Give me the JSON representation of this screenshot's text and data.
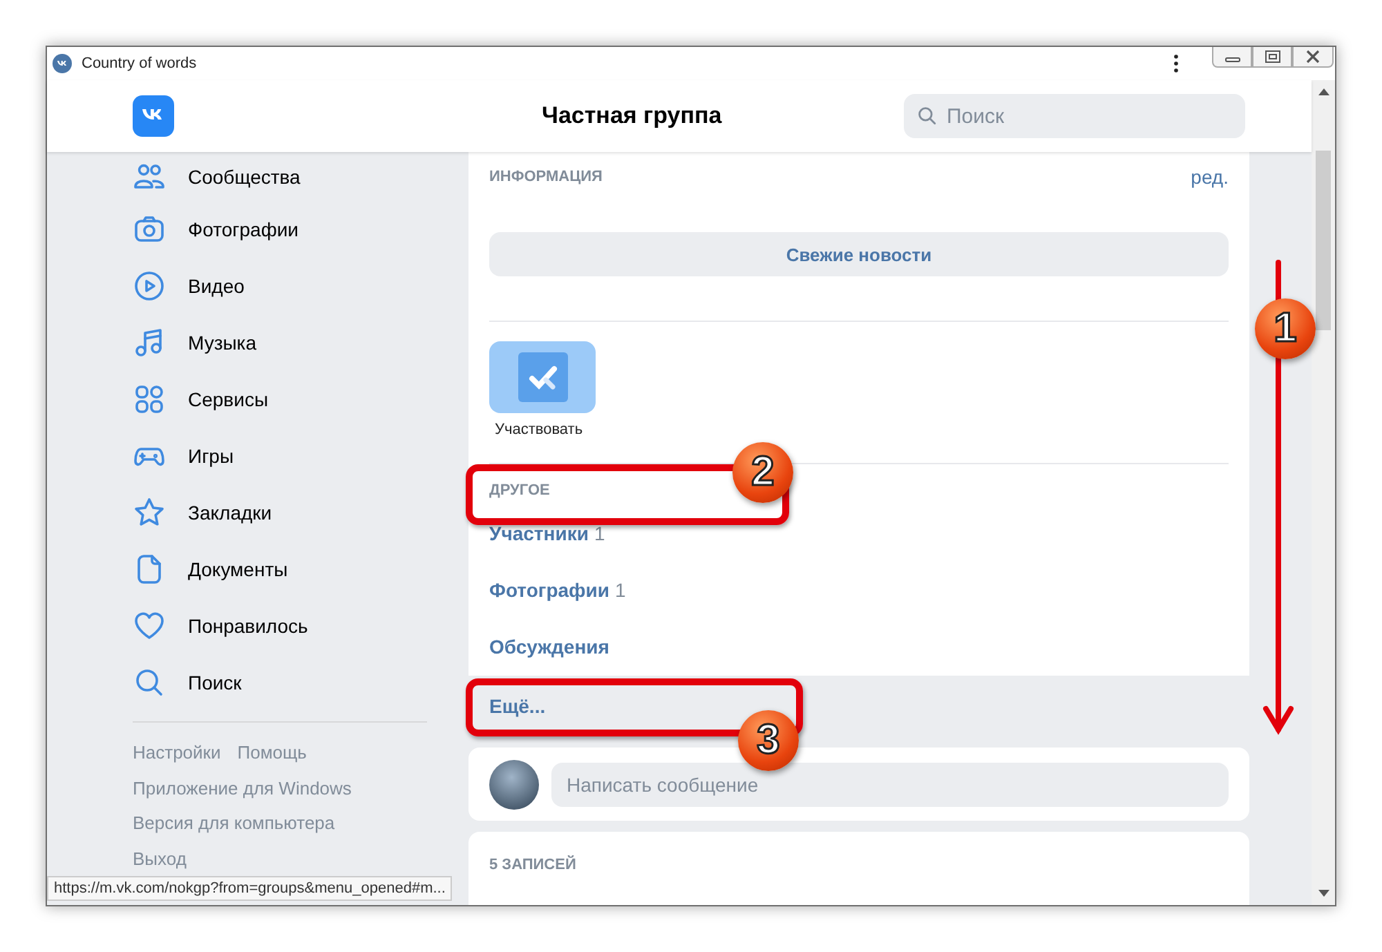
{
  "window": {
    "title": "Country of words"
  },
  "header": {
    "title": "Частная группа",
    "search_placeholder": "Поиск"
  },
  "sidebar": {
    "items": [
      {
        "label": "Сообщества"
      },
      {
        "label": "Фотографии"
      },
      {
        "label": "Видео"
      },
      {
        "label": "Музыка"
      },
      {
        "label": "Сервисы"
      },
      {
        "label": "Игры"
      },
      {
        "label": "Закладки"
      },
      {
        "label": "Документы"
      },
      {
        "label": "Понравилось"
      },
      {
        "label": "Поиск"
      }
    ],
    "footer_links": [
      [
        "Настройки",
        "Помощь"
      ],
      [
        "Приложение для Windows"
      ],
      [
        "Версия для компьютера"
      ],
      [
        "Выход"
      ]
    ]
  },
  "status_url": "https://m.vk.com/nokgp?from=groups&menu_opened#m...",
  "info": {
    "heading": "ИНФОРМАЦИЯ",
    "edit_link": "ред.",
    "button": "Свежие новости",
    "action": "Участвовать"
  },
  "other": {
    "heading": "ДРУГОЕ",
    "links": [
      {
        "label": "Участники",
        "count": "1",
        "highlighted": false
      },
      {
        "label": "Фотографии",
        "count": "1",
        "highlighted": false
      },
      {
        "label": "Обсуждения",
        "highlighted": false
      },
      {
        "label": "Ещё...",
        "highlighted": true
      }
    ]
  },
  "message": {
    "placeholder": "Написать сообщение"
  },
  "records": {
    "heading": "5 ЗАПИСЕЙ"
  },
  "annotations": [
    {
      "number": "1"
    },
    {
      "number": "2"
    },
    {
      "number": "3"
    }
  ]
}
